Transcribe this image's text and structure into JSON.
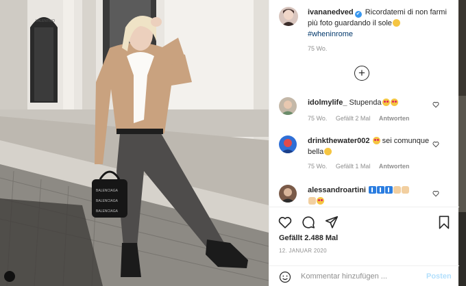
{
  "post": {
    "username": "ivananedved",
    "verified_mark": "✔",
    "caption_text": "Ricordatemi di non farmi più foto guardando il sole",
    "hashtag": "#wheninrome",
    "age": "75 Wo."
  },
  "comments": [
    {
      "username": "idolmylife_",
      "text": "Stupenda",
      "age": "75 Wo.",
      "likes": "Gefällt 2 Mal",
      "reply": "Antworten"
    },
    {
      "username": "drinkthewater002",
      "text": "sei comunque bella",
      "age": "75 Wo.",
      "likes": "Gefällt 1 Mal",
      "reply": "Antworten"
    },
    {
      "username": "alessandroartini",
      "text": ""
    }
  ],
  "actions": {
    "like_icon": "heart-icon",
    "comment_icon": "comment-bubble-icon",
    "share_icon": "paper-plane-icon",
    "save_icon": "bookmark-icon"
  },
  "likes_count": "Gefällt 2.488 Mal",
  "date": "12. JANUAR 2020",
  "comment_box": {
    "placeholder": "Kommentar hinzufügen ...",
    "post_label": "Posten"
  },
  "colors": {
    "link_blue": "#00376b",
    "post_disabled": "#b2dffc",
    "verified_blue": "#3897f0",
    "meta_gray": "#8e8e8e"
  }
}
